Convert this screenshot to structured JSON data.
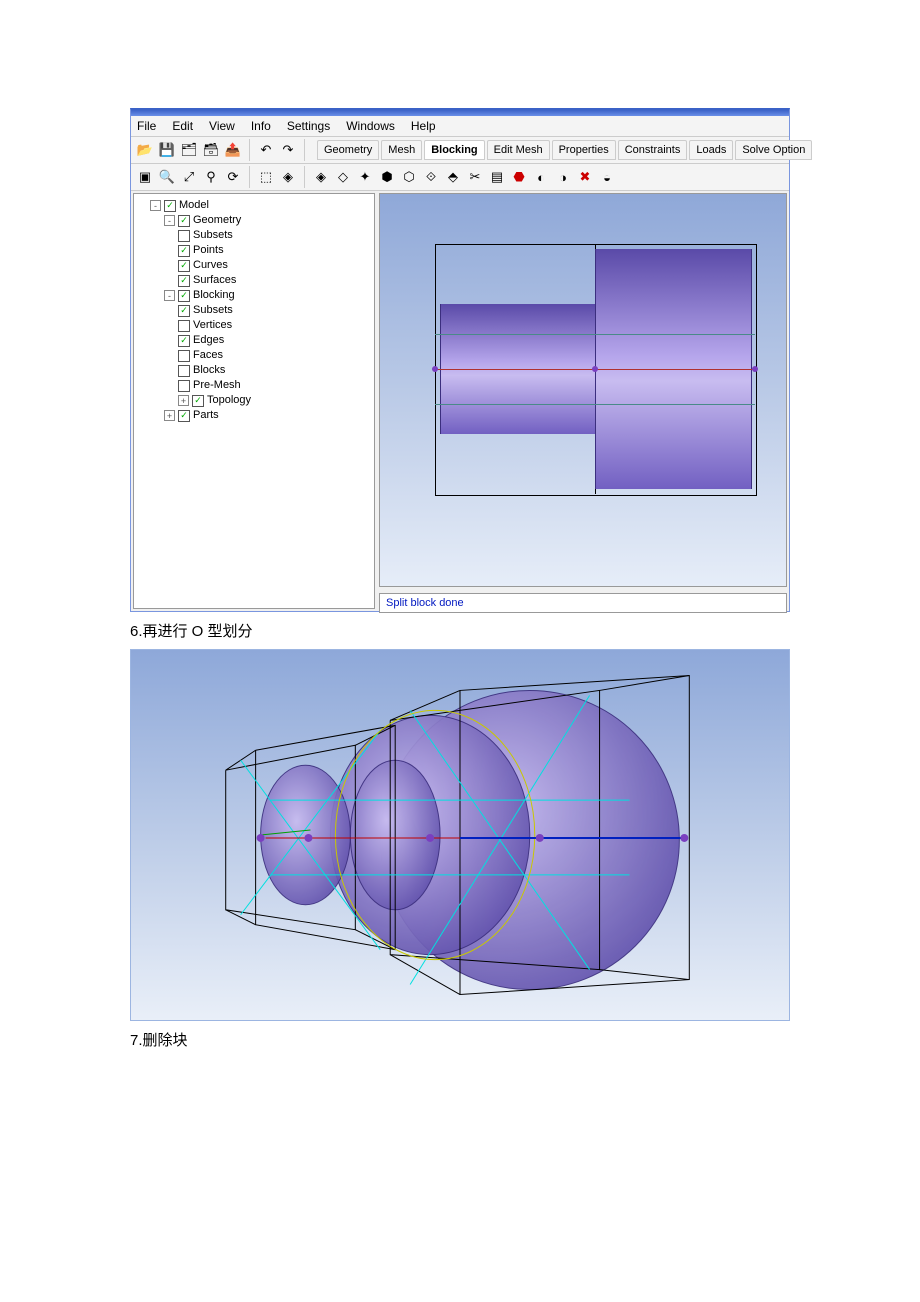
{
  "menu": {
    "file": "File",
    "edit": "Edit",
    "view": "View",
    "info": "Info",
    "settings": "Settings",
    "windows": "Windows",
    "help": "Help"
  },
  "tabs": {
    "geometry": "Geometry",
    "mesh": "Mesh",
    "blocking": "Blocking",
    "editmesh": "Edit Mesh",
    "properties": "Properties",
    "constraints": "Constraints",
    "loads": "Loads",
    "solve": "Solve Option"
  },
  "tree": {
    "model": "Model",
    "geometry": "Geometry",
    "subsets": "Subsets",
    "points": "Points",
    "curves": "Curves",
    "surfaces": "Surfaces",
    "blocking": "Blocking",
    "subsets2": "Subsets",
    "vertices": "Vertices",
    "edges": "Edges",
    "faces": "Faces",
    "blocks": "Blocks",
    "premesh": "Pre-Mesh",
    "topology": "Topology",
    "parts": "Parts"
  },
  "status": {
    "msg": "Split block done"
  },
  "captions": {
    "c6": "6.再进行 O 型划分",
    "c7": "7.删除块"
  },
  "icons": {
    "open": "📂",
    "save": "💾",
    "proj": "🗂",
    "geom": "🗃",
    "export": "📤",
    "undo": "↶",
    "redo": "↷",
    "zoom": "🔍",
    "box": "▣",
    "fit": "⤢",
    "axis": "⚲",
    "refresh": "⟳",
    "wire": "⬚",
    "solid1": "◈",
    "solid2": "◇",
    "tool1": "✦",
    "tool2": "⬢",
    "tool3": "⬡",
    "tool4": "⟐",
    "tool5": "⬘",
    "cut": "✂",
    "layer": "▤",
    "warn": "⬣",
    "misc1": "◐",
    "misc2": "◑",
    "del": "✖",
    "misc3": "◒"
  }
}
